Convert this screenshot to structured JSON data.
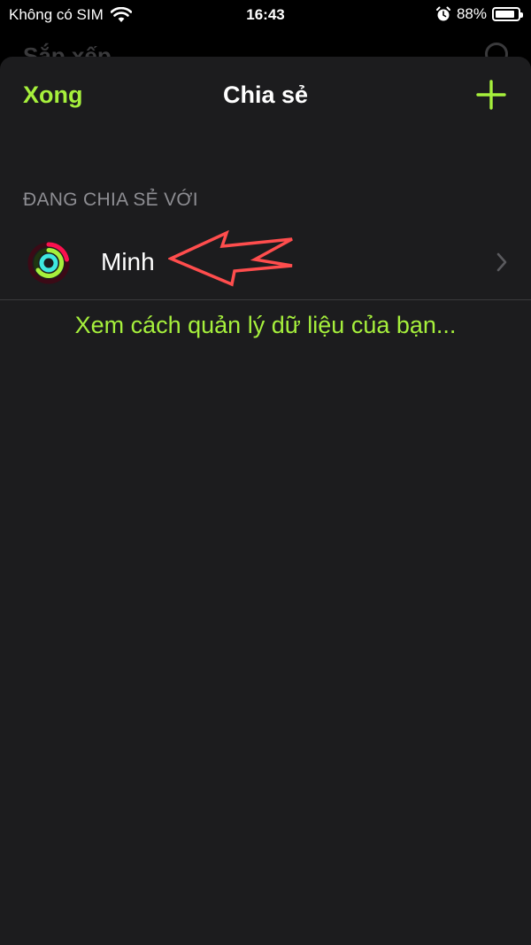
{
  "status_bar": {
    "carrier": "Không có SIM",
    "time": "16:43",
    "battery_percent": "88%",
    "battery_level": 0.88,
    "icons": [
      "wifi-icon",
      "alarm-icon",
      "battery-icon"
    ]
  },
  "background_page": {
    "title": "Sắp xếp"
  },
  "sheet": {
    "done_label": "Xong",
    "title": "Chia sẻ",
    "add_icon": "plus-icon",
    "section_header": "ĐANG CHIA SẺ VỚI",
    "contacts": [
      {
        "name": "Minh",
        "icon": "activity-rings-icon"
      }
    ],
    "manage_link": "Xem cách quản lý dữ liệu của bạn..."
  },
  "colors": {
    "accent": "#a6f03c",
    "sheet_background": "#1c1c1e",
    "secondary_text": "#8e8e93",
    "annotation": "#ff4d4d",
    "ring_move": "#fa114f",
    "ring_exercise": "#a6f03c",
    "ring_stand": "#3ee8e0"
  }
}
